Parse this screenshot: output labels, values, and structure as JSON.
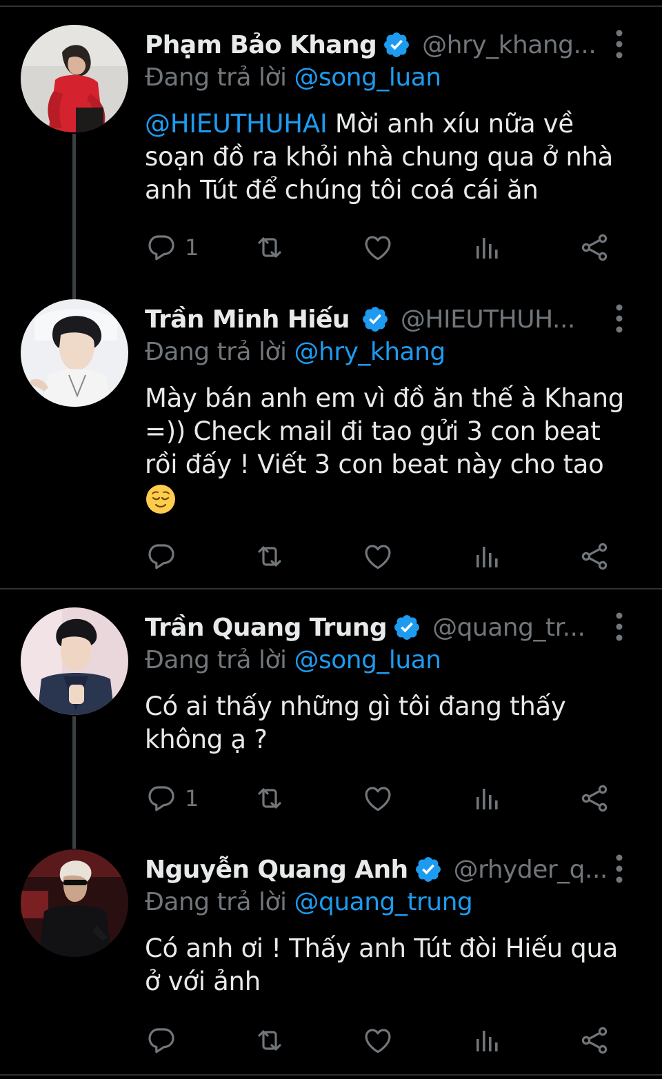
{
  "colors": {
    "background": "#000000",
    "text": "#e7e9ea",
    "muted": "#71767b",
    "accent": "#1d9bf0",
    "divider": "#2f3336"
  },
  "tweets": [
    {
      "name": "Phạm Bảo Khang",
      "handle": "@hry_khang...",
      "reply_prefix": "Đang trả lời ",
      "reply_to": "@song_luan",
      "mention": "@HIEUTHUHAI",
      "text_line1": " Mời anh xíu nữa về",
      "text_line2": "soạn đồ ra khỏi nhà chung qua ở nhà",
      "text_line3": "anh Tút để chúng tôi coá cái ăn",
      "reply_count": "1",
      "verified": true
    },
    {
      "name": "Trần Minh Hiếu",
      "handle": "@HIEUTHUH...",
      "reply_prefix": "Đang trả lời ",
      "reply_to": "@hry_khang",
      "text_line1": "Mày bán anh em vì đồ ăn thế à Khang",
      "text_line2": "=)) Check mail đi tao gửi 3 con beat",
      "text_line3": "rồi đấy  ! Viết 3 con beat này cho tao",
      "emoji": "relieved-face",
      "reply_count": "",
      "verified": true
    },
    {
      "name": "Trần Quang Trung",
      "handle": "@quang_tr...",
      "reply_prefix": "Đang trả lời ",
      "reply_to": "@song_luan",
      "text_line1": "Có ai thấy những gì tôi đang thấy",
      "text_line2": "không ạ ?",
      "reply_count": "1",
      "verified": true
    },
    {
      "name": "Nguyễn Quang Anh",
      "handle": "@rhyder_q...",
      "reply_prefix": "Đang trả lời ",
      "reply_to": "@quang_trung",
      "text_line1": "Có anh ơi ! Thấy anh Tút đòi Hiếu qua",
      "text_line2": "ở với ảnh",
      "reply_count": "",
      "verified": true
    }
  ],
  "icons": [
    "reply-icon",
    "retweet-icon",
    "like-icon",
    "views-icon",
    "share-icon",
    "more-icon",
    "verified-badge-icon"
  ]
}
